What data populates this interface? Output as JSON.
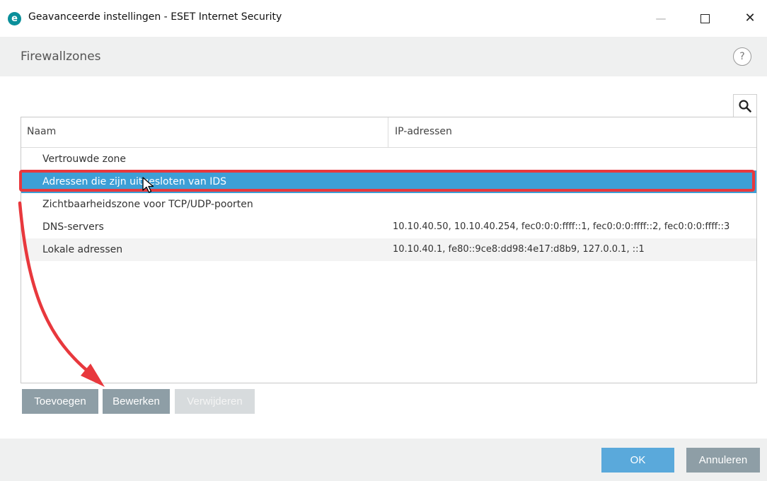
{
  "window": {
    "app_logo": "e",
    "title": "Geavanceerde instellingen - ESET Internet Security",
    "minimize": "—",
    "close": "✕"
  },
  "header": {
    "title": "Firewallzones",
    "help": "?"
  },
  "table": {
    "columns": [
      "Naam",
      "IP-adressen"
    ],
    "rows": [
      {
        "name": "Vertrouwde zone",
        "ip": ""
      },
      {
        "name": "Adressen die zijn uitgesloten van IDS",
        "ip": ""
      },
      {
        "name": "Zichtbaarheidszone voor TCP/UDP-poorten",
        "ip": ""
      },
      {
        "name": "DNS-servers",
        "ip": "10.10.40.50, 10.10.40.254, fec0:0:0:ffff::1, fec0:0:0:ffff::2, fec0:0:0:ffff::3"
      },
      {
        "name": "Lokale adressen",
        "ip": "10.10.40.1, fe80::9ce8:dd98:4e17:d8b9, 127.0.0.1, ::1"
      }
    ],
    "selected_index": 1
  },
  "actions": {
    "add": "Toevoegen",
    "edit": "Bewerken",
    "delete": "Verwijderen"
  },
  "footer": {
    "ok": "OK",
    "cancel": "Annuleren"
  },
  "colors": {
    "selection": "#3d9fd6",
    "annotation": "#e8383d",
    "button": "#8e9ea6",
    "ok_button": "#5aa9db"
  }
}
